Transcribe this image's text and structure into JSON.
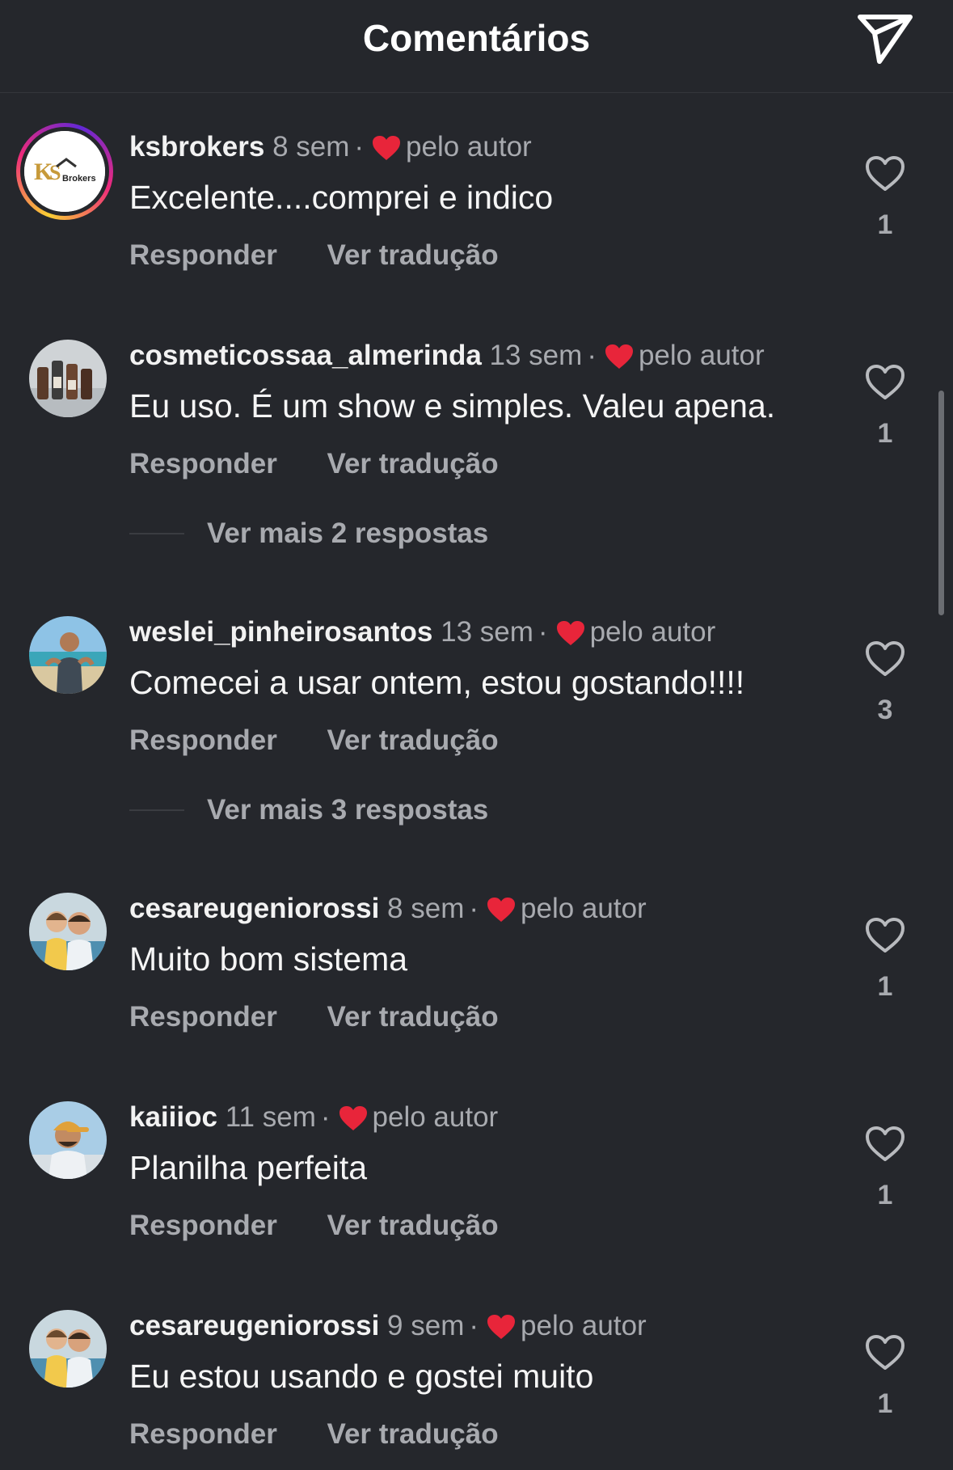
{
  "header": {
    "title": "Comentários",
    "share_icon": "send-icon"
  },
  "labels": {
    "reply": "Responder",
    "translate": "Ver tradução",
    "by_author": "pelo autor",
    "dot": "·"
  },
  "colors": {
    "background": "#25272c",
    "secondary_text": "#a8aaaf",
    "author_heart": "#e8253a"
  },
  "comments": [
    {
      "username": "ksbrokers",
      "time": "8 sem",
      "text": "Excelente....comprei e indico",
      "likes": "1",
      "avatar": "ksbrokers-logo"
    },
    {
      "username": "cosmeticossaa_almerinda",
      "time": "13 sem",
      "text": "Eu uso. É um show e simples. Valeu apena.",
      "likes": "1",
      "more_replies": "Ver mais 2 respostas",
      "avatar": "products-photo"
    },
    {
      "username": "weslei_pinheirosantos",
      "time": "13 sem",
      "text": "Comecei a usar ontem, estou gostando!!!!",
      "likes": "3",
      "more_replies": "Ver mais 3 respostas",
      "avatar": "beach-photo"
    },
    {
      "username": "cesareugeniorossi",
      "time": "8 sem",
      "text": "Muito bom sistema",
      "likes": "1",
      "avatar": "family-photo"
    },
    {
      "username": "kaiiioc",
      "time": "11 sem",
      "text": "Planilha perfeita",
      "likes": "1",
      "avatar": "cap-man-photo"
    },
    {
      "username": "cesareugeniorossi",
      "time": "9 sem",
      "text": "Eu estou usando e gostei muito",
      "likes": "1",
      "avatar": "family-photo"
    }
  ]
}
